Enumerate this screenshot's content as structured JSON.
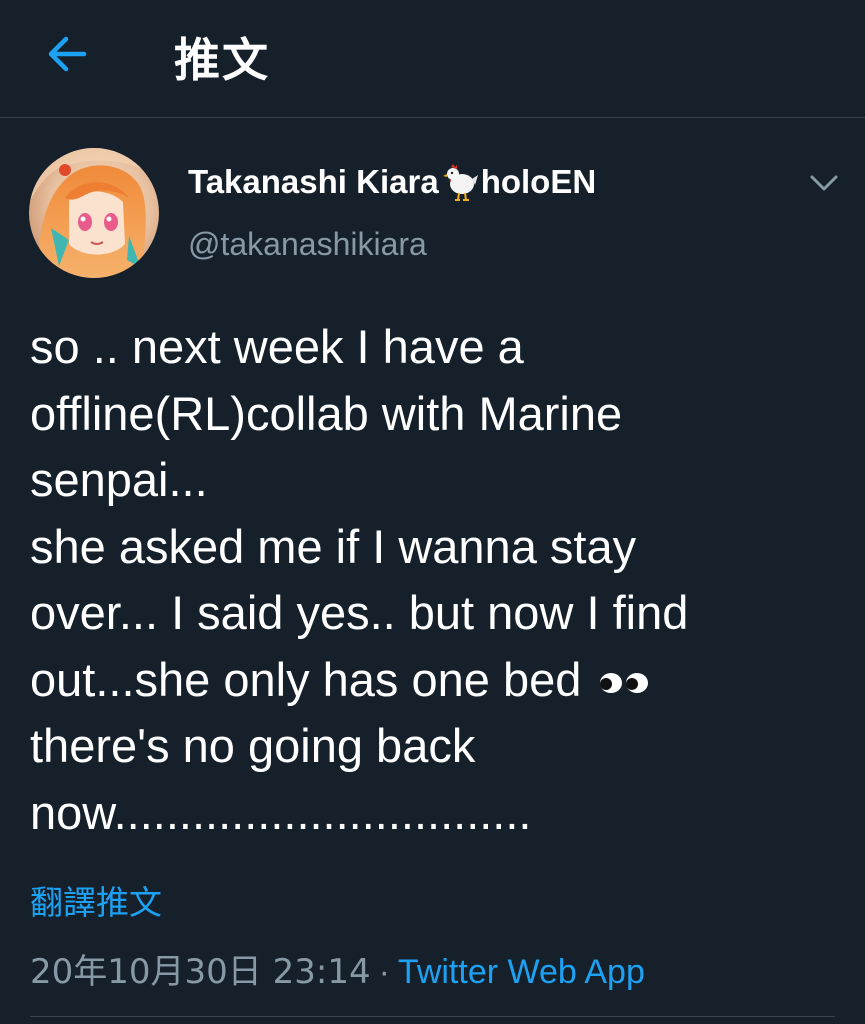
{
  "header": {
    "title": "推文",
    "back_icon": "arrow-left-icon",
    "accent_color": "#1da1f2"
  },
  "tweet": {
    "author": {
      "display_name": "Takanashi Kiara",
      "name_emoji": "chicken-icon",
      "name_suffix": "holoEN",
      "handle": "@takanashikiara",
      "avatar": "avatar-image"
    },
    "menu_icon": "chevron-down-icon",
    "text_lines": [
      "so .. next week I have a",
      "offline(RL)collab with Marine",
      "senpai...",
      "she asked me if I wanna stay",
      "over... I said yes.. but now I find",
      "out...she only has one bed",
      "there's no going back",
      "now................................"
    ],
    "eyes_emoji": "eyes-icon",
    "translate_label": "翻譯推文",
    "timestamp": "20年10月30日 23:14",
    "separator": "·",
    "source": "Twitter Web App"
  },
  "colors": {
    "background": "#15202b",
    "divider": "#38444d",
    "secondary_text": "#8899a6",
    "link": "#1da1f2"
  }
}
